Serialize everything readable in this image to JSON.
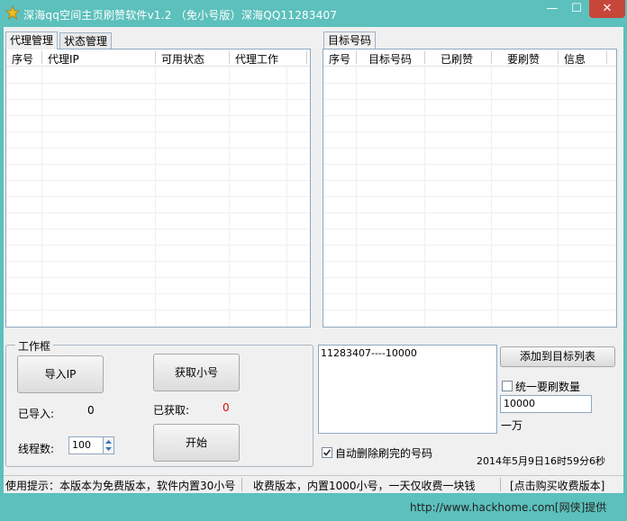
{
  "window": {
    "title": "深海qq空间主页刷赞软件v1.2 （免小号版）深海QQ11283407",
    "minimize_glyph": "—",
    "maximize_glyph": "☐",
    "close_glyph": "✕",
    "colors": {
      "frame": "#5cc0bc",
      "close": "#c7463a"
    }
  },
  "left_tabs": [
    {
      "label": "代理管理",
      "selected": true
    },
    {
      "label": "状态管理",
      "selected": false
    }
  ],
  "proxy_table": {
    "columns": [
      "序号",
      "代理IP",
      "可用状态",
      "代理工作"
    ]
  },
  "right_tabs": [
    {
      "label": "目标号码",
      "selected": true
    }
  ],
  "target_table": {
    "columns": [
      "序号",
      "目标号码",
      "已刷赞",
      "要刷赞",
      "信息"
    ]
  },
  "workbox": {
    "title": "工作框",
    "import_ip_button": "导入IP",
    "get_account_button": "获取小号",
    "imported_label": "已导入:",
    "imported_value": "0",
    "obtained_label": "已获取:",
    "obtained_value": "0",
    "threads_label": "线程数:",
    "threads_value": "100",
    "start_button": "开始"
  },
  "target_input": {
    "text": "11283407----10000",
    "add_button": "添加到目标列表",
    "unify_checkbox_label": "统一要刷数量",
    "unify_checked": false,
    "amount_value": "10000",
    "amount_unit": "一万",
    "auto_delete_label": "自动删除刷完的号码",
    "auto_delete_checked": true,
    "datetime": "2014年5月9日16时59分6秒"
  },
  "statusbar": {
    "tip": "使用提示：本版本为免费版本，软件内置30小号",
    "paid": "收费版本，内置1000小号，一天仅收费一块钱",
    "buy": "[点击购买收费版本]"
  },
  "watermark": "http://www.hackhome.com[网侠]提供"
}
